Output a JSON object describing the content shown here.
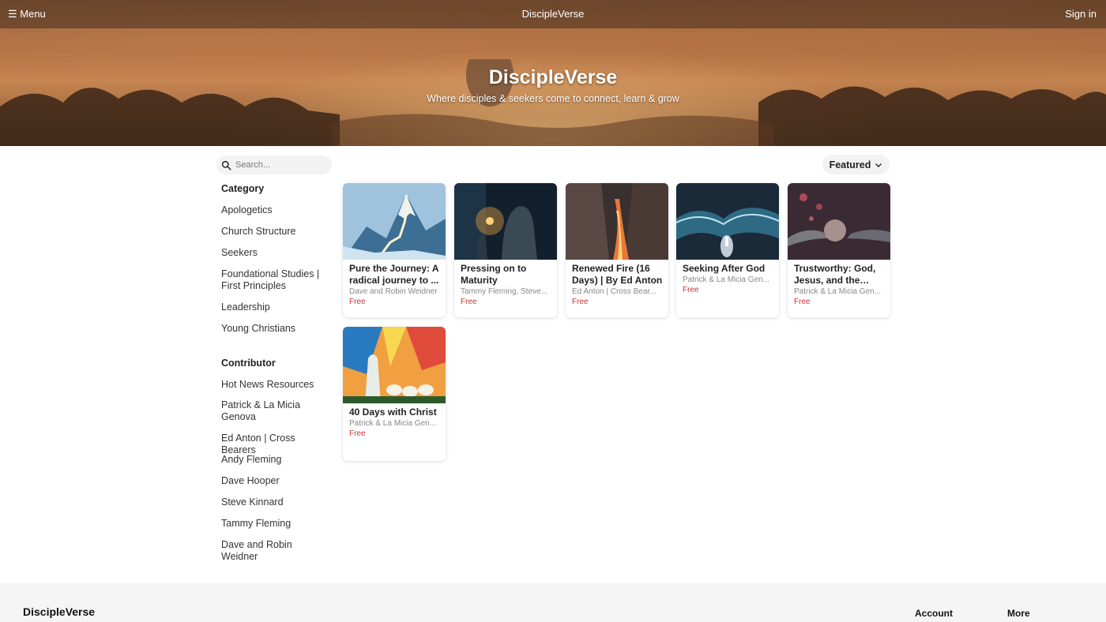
{
  "header": {
    "menu_label": "☰ Menu",
    "brand": "DiscipleVerse",
    "signin_label": "Sign in"
  },
  "hero": {
    "title": "DiscipleVerse",
    "subtitle": "Where disciples & seekers come to connect, learn & grow"
  },
  "search": {
    "placeholder": "Search..."
  },
  "sort": {
    "label": "Featured"
  },
  "sidebar": {
    "category_heading": "Category",
    "categories": [
      "Apologetics",
      "Church Structure",
      "Seekers",
      "Foundational Studies | First Principles",
      "Leadership",
      "Young Christians"
    ],
    "contributor_heading": "Contributor",
    "contributors": [
      "Hot News Resources",
      "Patrick & La Micia Genova",
      "Ed Anton | Cross Bearers",
      "Andy Fleming",
      "Dave Hooper",
      "Steve Kinnard",
      "Tammy Fleming",
      "Dave and Robin Weidner"
    ]
  },
  "courses": [
    {
      "title": "Pure the Journey: A radical journey to ...",
      "author": "Dave and Robin Weidner",
      "price": "Free"
    },
    {
      "title": "Pressing on to Maturity",
      "author": "Tammy Fleming, Steve...",
      "price": "Free"
    },
    {
      "title": "Renewed Fire (16 Days) | By Ed Anton",
      "author": "Ed Anton | Cross Bear...",
      "price": "Free"
    },
    {
      "title": "Seeking After God",
      "author": "Patrick & La Micia Gen...",
      "price": "Free"
    },
    {
      "title": "Trustworthy: God, Jesus, and the Bible",
      "author": "Patrick & La Micia Gen...",
      "price": "Free"
    },
    {
      "title": "40 Days with Christ",
      "author": "Patrick & La Micia Gen...",
      "price": "Free"
    }
  ],
  "footer": {
    "brand": "DiscipleVerse",
    "account_label": "Account",
    "more_label": "More"
  }
}
